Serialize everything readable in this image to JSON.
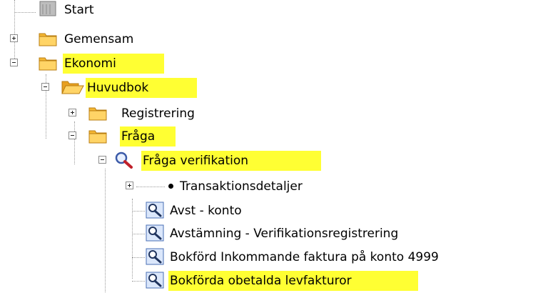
{
  "tree": {
    "items": [
      {
        "label": "Start",
        "icon": "document-stack-icon",
        "expander": "none",
        "highlighted": false
      },
      {
        "label": "Gemensam",
        "icon": "folder-closed-icon",
        "expander": "plus",
        "highlighted": false
      },
      {
        "label": "Ekonomi",
        "icon": "folder-closed-icon",
        "expander": "minus",
        "highlighted": true
      },
      {
        "label": "Huvudbok",
        "icon": "folder-open-icon",
        "expander": "minus",
        "highlighted": true
      },
      {
        "label": "Registrering",
        "icon": "folder-closed-icon",
        "expander": "plus",
        "highlighted": false
      },
      {
        "label": "Fråga",
        "icon": "folder-closed-icon",
        "expander": "minus",
        "highlighted": true
      },
      {
        "label": "Fråga verifikation",
        "icon": "magnifier-icon",
        "expander": "minus",
        "highlighted": true
      },
      {
        "label": "Transaktionsdetaljer",
        "icon": "bullet-icon",
        "expander": "plus",
        "highlighted": false
      },
      {
        "label": "Avst - konto",
        "icon": "search-report-icon",
        "expander": "none",
        "highlighted": false
      },
      {
        "label": "Avstämning - Verifikationsregistrering",
        "icon": "search-report-icon",
        "expander": "none",
        "highlighted": false
      },
      {
        "label": "Bokförd Inkommande faktura på konto 4999",
        "icon": "search-report-icon",
        "expander": "none",
        "highlighted": false
      },
      {
        "label": "Bokförda obetalda levfakturor",
        "icon": "search-report-icon",
        "expander": "none",
        "highlighted": true
      }
    ]
  },
  "colors": {
    "highlight": "#ffff33",
    "folder": "#f5b733",
    "tree_line": "#9a9a9a"
  }
}
